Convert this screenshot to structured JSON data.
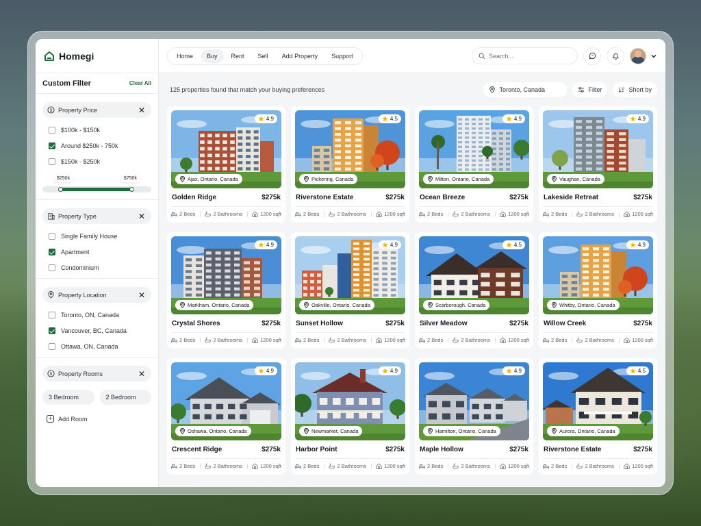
{
  "app": {
    "name": "Homegi"
  },
  "filter": {
    "title": "Custom Filter",
    "clear_all": "Clear All",
    "price": {
      "label": "Property Price",
      "options": [
        {
          "label": "$100k - $150k",
          "checked": false
        },
        {
          "label": "Around $250k - 750k",
          "checked": true
        },
        {
          "label": "$150k - $250k",
          "checked": false
        }
      ],
      "range_min": "$250k",
      "range_max": "$750k"
    },
    "type": {
      "label": "Property Type",
      "options": [
        {
          "label": "Single Family House",
          "checked": false
        },
        {
          "label": "Apartment",
          "checked": true
        },
        {
          "label": "Condominium",
          "checked": false
        }
      ]
    },
    "location": {
      "label": "Property Location",
      "options": [
        {
          "label": "Toronto, ON, Canada",
          "checked": false
        },
        {
          "label": "Vancouver, BC, Canada",
          "checked": true
        },
        {
          "label": "Ottawa, ON, Canada",
          "checked": false
        }
      ]
    },
    "rooms": {
      "label": "Property Rooms",
      "pills": [
        "3 Bedroom",
        "2 Bedroom"
      ],
      "add_label": "Add Room"
    }
  },
  "nav": {
    "items": [
      "Home",
      "Buy",
      "Rent",
      "Sell",
      "Add Property",
      "Support"
    ],
    "active": "Buy"
  },
  "search": {
    "placeholder": "Search..."
  },
  "results": {
    "summary": "125 properties found that match your buying preferences",
    "location": "Toronto, Canada",
    "filter_label": "Filter",
    "sort_label": "Short by"
  },
  "colors": {
    "accent": "#1d6b3e",
    "star": "#f5b301"
  },
  "listings": [
    {
      "name": "Golden Ridge",
      "price": "$275k",
      "rating": "4.9",
      "location": "Ajax, Ontario, Canada",
      "beds": "2 Beds",
      "baths": "2 Bathrooms",
      "area": "1200 sqft",
      "style": "apartment-red",
      "sky": "#7db6e6"
    },
    {
      "name": "Riverstone Estate",
      "price": "$275k",
      "rating": "4.5",
      "location": "Pickering, Canada",
      "beds": "2 Beds",
      "baths": "2 Bathrooms",
      "area": "1200 sqft",
      "style": "apartment-orange",
      "sky": "#4f93d8"
    },
    {
      "name": "Ocean Breeze",
      "price": "$275k",
      "rating": "4.9",
      "location": "Milton, Ontario, Canada",
      "beds": "2 Beds",
      "baths": "2 Bathrooms",
      "area": "1200 sqft",
      "style": "tower-white",
      "sky": "#5aa2e2"
    },
    {
      "name": "Lakeside Retreat",
      "price": "$275k",
      "rating": "4.9",
      "location": "Vaughan, Canada",
      "beds": "2 Beds",
      "baths": "2 Bathrooms",
      "area": "1200 sqft",
      "style": "apartment-grey",
      "sky": "#9cc6ec"
    },
    {
      "name": "Crystal Shores",
      "price": "$275k",
      "rating": "4.9",
      "location": "Markham, Ontario, Canada",
      "beds": "2 Beds",
      "baths": "2 Bathrooms",
      "area": "1200 sqft",
      "style": "apartment-dark",
      "sky": "#4a8fd6"
    },
    {
      "name": "Sunset Hollow",
      "price": "$275k",
      "rating": "4.9",
      "location": "Oakville, Ontario, Canada",
      "beds": "2 Beds",
      "baths": "2 Bathrooms",
      "area": "1200 sqft",
      "style": "apartment-colorful",
      "sky": "#a9cfee"
    },
    {
      "name": "Silver Meadow",
      "price": "$275k",
      "rating": "4.5",
      "location": "Scarborough, Canada",
      "beds": "2 Beds",
      "baths": "2 Bathrooms",
      "area": "1200 sqft",
      "style": "house-brown",
      "sky": "#3f86d3"
    },
    {
      "name": "Willow Creek",
      "price": "$275k",
      "rating": "4.9",
      "location": "Whitby, Ontario, Canada",
      "beds": "2 Beds",
      "baths": "2 Bathrooms",
      "area": "1200 sqft",
      "style": "apartment-orange",
      "sky": "#5d9fdf"
    },
    {
      "name": "Crescent Ridge",
      "price": "$275k",
      "rating": "4.9",
      "location": "Oshawa, Ontario, Canada",
      "beds": "2 Beds",
      "baths": "2 Bathrooms",
      "area": "1200 sqft",
      "style": "house-grey",
      "sky": "#5ea4e4"
    },
    {
      "name": "Harbor Point",
      "price": "$275k",
      "rating": "4.9",
      "location": "Newmarket, Canada",
      "beds": "2 Beds",
      "baths": "2 Bathrooms",
      "area": "1200 sqft",
      "style": "house-blue",
      "sky": "#8fbfe6"
    },
    {
      "name": "Maple Hollow",
      "price": "$275k",
      "rating": "4.9",
      "location": "Hamilton, Ontario, Canada",
      "beds": "2 Beds",
      "baths": "2 Bathrooms",
      "area": "1200 sqft",
      "style": "street",
      "sky": "#3c84d4"
    },
    {
      "name": "Riverstone Estate",
      "price": "$275k",
      "rating": "4.5",
      "location": "Aurora, Ontario, Canada",
      "beds": "2 Beds",
      "baths": "2 Bathrooms",
      "area": "1200 sqft",
      "style": "house-beige",
      "sky": "#2f7ad0"
    }
  ]
}
